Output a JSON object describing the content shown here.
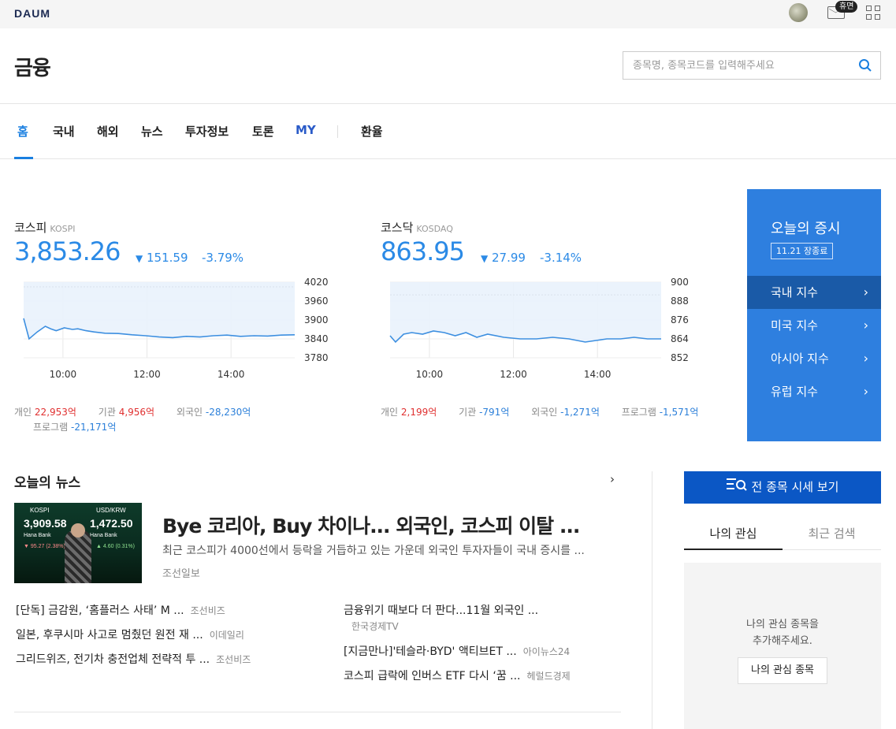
{
  "topbar": {
    "logo": "DAUM",
    "mail_badge": "휴면"
  },
  "header": {
    "title": "금융",
    "search_placeholder": "종목명, 종목코드를 입력해주세요"
  },
  "nav": {
    "items": [
      "홈",
      "국내",
      "해외",
      "뉴스",
      "투자정보",
      "토론",
      "MY",
      "환율"
    ],
    "active": "홈"
  },
  "kospi": {
    "name": "코스피",
    "code": "KOSPI",
    "value": "3,853.26",
    "change": "151.59",
    "rate": "-3.79%",
    "flows": {
      "individual_label": "개인",
      "individual": "22,953억",
      "inst_label": "기관",
      "inst": "4,956억",
      "foreign_label": "외국인",
      "foreign": "-28,230억",
      "program_label": "프로그램",
      "program": "-21,171억"
    }
  },
  "kosdaq": {
    "name": "코스닥",
    "code": "KOSDAQ",
    "value": "863.95",
    "change": "27.99",
    "rate": "-3.14%",
    "flows": {
      "individual_label": "개인",
      "individual": "2,199억",
      "inst_label": "기관",
      "inst": "-791억",
      "foreign_label": "외국인",
      "foreign": "-1,271억",
      "program_label": "프로그램",
      "program": "-1,571억"
    }
  },
  "chart_data": [
    {
      "type": "line",
      "name": "KOSPI",
      "x_ticks": [
        "10:00",
        "12:00",
        "14:00"
      ],
      "y_ticks": [
        4020,
        3960,
        3900,
        3840,
        3780
      ],
      "ylim": [
        3780,
        4020
      ],
      "prev_close": 4004.85,
      "x": [
        0,
        0.02,
        0.05,
        0.08,
        0.1,
        0.12,
        0.15,
        0.18,
        0.2,
        0.23,
        0.26,
        0.3,
        0.35,
        0.4,
        0.45,
        0.5,
        0.55,
        0.6,
        0.65,
        0.7,
        0.75,
        0.8,
        0.85,
        0.9,
        0.95,
        1.0
      ],
      "values": [
        3905,
        3840,
        3862,
        3880,
        3872,
        3866,
        3875,
        3870,
        3872,
        3866,
        3862,
        3858,
        3857,
        3853,
        3850,
        3846,
        3844,
        3848,
        3846,
        3850,
        3852,
        3848,
        3850,
        3849,
        3852,
        3853
      ]
    },
    {
      "type": "line",
      "name": "KOSDAQ",
      "x_ticks": [
        "10:00",
        "12:00",
        "14:00"
      ],
      "y_ticks": [
        900,
        888,
        876,
        864,
        852
      ],
      "ylim": [
        852,
        900
      ],
      "prev_close": 891.94,
      "x": [
        0,
        0.02,
        0.05,
        0.08,
        0.12,
        0.16,
        0.2,
        0.24,
        0.28,
        0.32,
        0.36,
        0.42,
        0.48,
        0.54,
        0.6,
        0.66,
        0.72,
        0.76,
        0.8,
        0.85,
        0.9,
        0.95,
        1.0
      ],
      "values": [
        866,
        862,
        867,
        868,
        867,
        869,
        868,
        866,
        868,
        865,
        867,
        865,
        864,
        864,
        865,
        864,
        862,
        863,
        864,
        864,
        865,
        864,
        864
      ]
    }
  ],
  "today_market": {
    "title": "오늘의 증시",
    "date": "11.21 장종료",
    "items": [
      "국내 지수",
      "미국 지수",
      "아시아 지수",
      "유럽 지수"
    ]
  },
  "news": {
    "heading": "오늘의 뉴스",
    "thumb": {
      "kospi_label": "KOSPI",
      "kospi_value": "3,909.58",
      "kospi_chg": "▼ 95.27 (2.38%)",
      "fx_label": "USD/KRW",
      "fx_value": "1,472.50",
      "fx_chg": "▲ 4.60 (0.31%)",
      "bank": "Hana Bank"
    },
    "top": {
      "title": "Bye 코리아, Buy 차이나... 외국인, 코스피 이탈 ...",
      "lead": "최근 코스피가 4000선에서 등락을 거듭하고 있는 가운데 외국인 투자자들이 국내 증시를 ...",
      "source": "조선일보"
    },
    "left": [
      {
        "title": "[단독] 금감원, ‘홈플러스 사태’ M ...",
        "source": "조선비즈"
      },
      {
        "title": "일본, 후쿠시마 사고로 멈췄던 원전 재 ...",
        "source": "이데일리"
      },
      {
        "title": "그리드위즈, 전기차 충전업체 전략적 투 ...",
        "source": "조선비즈"
      }
    ],
    "right": [
      {
        "title": "금융위기 때보다 더 판다...11월 외국인 ...",
        "source": "한국경제TV"
      },
      {
        "title": "[지금만나]'테슬라·BYD' 액티브ET ...",
        "source": "아이뉴스24"
      },
      {
        "title": "코스피 급락에 인버스 ETF 다시 ‘꿈 ...",
        "source": "헤럴드경제"
      }
    ]
  },
  "side": {
    "all_button": "전 종목 시세 보기",
    "tab_watch": "나의 관심",
    "tab_recent": "최근 검색",
    "empty_line1": "나의 관심 종목을",
    "empty_line2": "추가해주세요.",
    "add_button": "나의 관심 종목"
  },
  "colors": {
    "accent": "#1a7fe0",
    "down": "#2b8ae6",
    "up": "#e03030",
    "panel": "#2e7fdf",
    "panel_selected": "#1a5aa7",
    "button": "#0b57c5"
  }
}
